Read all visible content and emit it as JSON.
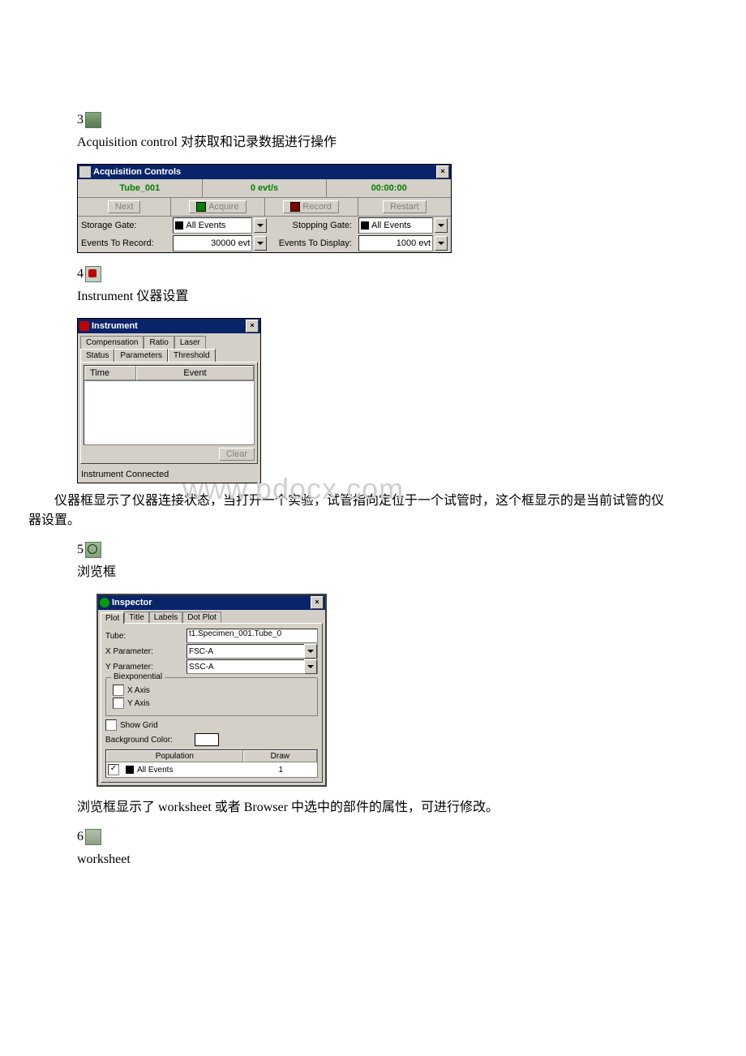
{
  "sec3": {
    "num": "3",
    "para": "Acquisition control 对获取和记录数据进行操作"
  },
  "acq": {
    "title": "Acquisition Controls",
    "tube": "Tube_001",
    "rate": "0 evt/s",
    "time": "00:00:00",
    "btn_next": "Next",
    "btn_acquire": "Acquire",
    "btn_record": "Record",
    "btn_restart": "Restart",
    "lbl_storage": "Storage Gate:",
    "val_storage": "All Events",
    "lbl_stopping": "Stopping Gate:",
    "val_stopping": "All Events",
    "lbl_record": "Events To Record:",
    "val_record": "30000 evt",
    "lbl_display": "Events To Display:",
    "val_display": "1000 evt"
  },
  "sec4": {
    "num": "4",
    "para": "Instrument 仪器设置"
  },
  "instr": {
    "title": "Instrument",
    "tabs_back": [
      "Compensation",
      "Ratio",
      "Laser"
    ],
    "tabs_front": [
      "Status",
      "Parameters",
      "Threshold"
    ],
    "col_time": "Time",
    "col_event": "Event",
    "btn_clear": "Clear",
    "status": "Instrument Connected"
  },
  "watermark": "www.bdocx.com",
  "after_instr": "仪器框显示了仪器连接状态，当打开一个实验，试管指向定位于一个试管时，这个框显示的是当前试管的仪器设置。",
  "sec5": {
    "num": "5",
    "para": "浏览框"
  },
  "insp": {
    "title": "Inspector",
    "tabs": [
      "Plot",
      "Title",
      "Labels",
      "Dot Plot"
    ],
    "lbl_tube": "Tube:",
    "val_tube": "t1.Specimen_001.Tube_0",
    "lbl_x": "X Parameter:",
    "val_x": "FSC-A",
    "lbl_y": "Y Parameter:",
    "val_y": "SSC-A",
    "legend": "Biexponential",
    "cb_x": "X Axis",
    "cb_y": "Y Axis",
    "cb_grid": "Show Grid",
    "lbl_bg": "Background Color:",
    "col_pop": "Population",
    "col_draw": "Draw",
    "pop_name": "All Events",
    "pop_draw": "1"
  },
  "after_insp": "浏览框显示了 worksheet 或者 Browser 中选中的部件的属性，可进行修改。",
  "sec6": {
    "num": "6",
    "para": "worksheet"
  }
}
